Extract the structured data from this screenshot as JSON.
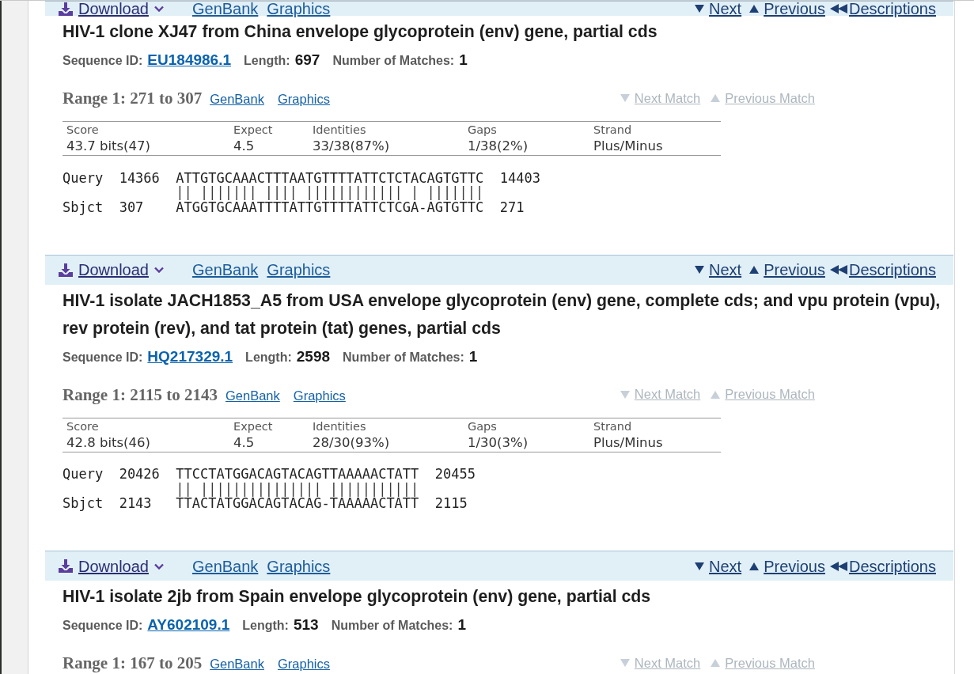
{
  "hits": [
    {
      "toolbar": {
        "download": "Download",
        "links": [
          "GenBank",
          "Graphics"
        ],
        "nav": [
          {
            "kind": "next",
            "label": "Next"
          },
          {
            "kind": "previous",
            "label": "Previous"
          },
          {
            "kind": "descriptions",
            "label": "Descriptions"
          }
        ]
      },
      "title": "HIV-1 clone XJ47 from China envelope glycoprotein (env) gene, partial cds",
      "sequence_id": {
        "label": "Sequence ID:",
        "value": "EU184986.1"
      },
      "length": {
        "label": "Length:",
        "value": "697"
      },
      "matches": {
        "label": "Number of Matches:",
        "value": "1"
      },
      "ranges": [
        {
          "title": "Range 1: 271 to 307",
          "links": [
            "GenBank",
            "Graphics"
          ],
          "match_nav": [
            {
              "kind": "next",
              "label": "Next Match",
              "disabled": true
            },
            {
              "kind": "previous",
              "label": "Previous Match",
              "disabled": true
            }
          ],
          "stats": {
            "columns": [
              "Score",
              "Expect",
              "Identities",
              "Gaps",
              "Strand"
            ],
            "values": [
              "43.7 bits(47)",
              "4.5",
              "33/38(87%)",
              "1/38(2%)",
              "Plus/Minus"
            ]
          },
          "alignment": [
            {
              "kind": "query",
              "label": "Query",
              "start": "14366",
              "sequence": "ATTGTGCAAACTTTAATGTTTTATTCTCTACAGTGTTC",
              "end": "14403"
            },
            {
              "kind": "match",
              "sequence": "|| ||||||| |||| |||||||||||| | |||||||"
            },
            {
              "kind": "subject",
              "label": "Sbjct",
              "start": "307",
              "sequence": "ATGGTGCAAATTTTATTGTTTTATTCTCGA-AGTGTTC",
              "end": "271"
            }
          ]
        }
      ]
    },
    {
      "toolbar": {
        "download": "Download",
        "links": [
          "GenBank",
          "Graphics"
        ],
        "nav": [
          {
            "kind": "next",
            "label": "Next"
          },
          {
            "kind": "previous",
            "label": "Previous"
          },
          {
            "kind": "descriptions",
            "label": "Descriptions"
          }
        ]
      },
      "title": "HIV-1 isolate JACH1853_A5 from USA envelope glycoprotein (env) gene, complete cds; and vpu protein (vpu), rev protein (rev), and tat protein (tat) genes, partial cds",
      "sequence_id": {
        "label": "Sequence ID:",
        "value": "HQ217329.1"
      },
      "length": {
        "label": "Length:",
        "value": "2598"
      },
      "matches": {
        "label": "Number of Matches:",
        "value": "1"
      },
      "ranges": [
        {
          "title": "Range 1: 2115 to 2143",
          "links": [
            "GenBank",
            "Graphics"
          ],
          "match_nav": [
            {
              "kind": "next",
              "label": "Next Match",
              "disabled": true
            },
            {
              "kind": "previous",
              "label": "Previous Match",
              "disabled": true
            }
          ],
          "stats": {
            "columns": [
              "Score",
              "Expect",
              "Identities",
              "Gaps",
              "Strand"
            ],
            "values": [
              "42.8 bits(46)",
              "4.5",
              "28/30(93%)",
              "1/30(3%)",
              "Plus/Minus"
            ]
          },
          "alignment": [
            {
              "kind": "query",
              "label": "Query",
              "start": "20426",
              "sequence": "TTCCTATGGACAGTACAGTTAAAAACTATT",
              "end": "20455"
            },
            {
              "kind": "match",
              "sequence": "|| ||||||||||||||| |||||||||||"
            },
            {
              "kind": "subject",
              "label": "Sbjct",
              "start": "2143",
              "sequence": "TTACTATGGACAGTACAG-TAAAAACTATT",
              "end": "2115"
            }
          ]
        }
      ]
    },
    {
      "toolbar": {
        "download": "Download",
        "links": [
          "GenBank",
          "Graphics"
        ],
        "nav": [
          {
            "kind": "next",
            "label": "Next"
          },
          {
            "kind": "previous",
            "label": "Previous"
          },
          {
            "kind": "descriptions",
            "label": "Descriptions"
          }
        ]
      },
      "title": "HIV-1 isolate 2jb from Spain envelope glycoprotein (env) gene, partial cds",
      "sequence_id": {
        "label": "Sequence ID:",
        "value": "AY602109.1"
      },
      "length": {
        "label": "Length:",
        "value": "513"
      },
      "matches": {
        "label": "Number of Matches:",
        "value": "1"
      },
      "ranges": [
        {
          "title": "Range 1: 167 to 205",
          "links": [
            "GenBank",
            "Graphics"
          ],
          "match_nav": [
            {
              "kind": "next",
              "label": "Next Match",
              "disabled": true
            },
            {
              "kind": "previous",
              "label": "Previous Match",
              "disabled": true
            }
          ]
        }
      ]
    }
  ]
}
